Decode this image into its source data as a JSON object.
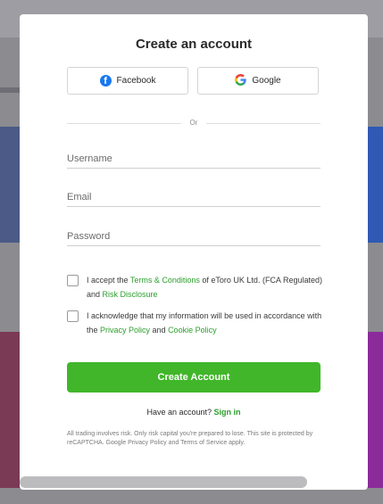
{
  "modal": {
    "title": "Create an account",
    "social": {
      "facebook_label": "Facebook",
      "google_label": "Google"
    },
    "or_text": "Or",
    "fields": {
      "username_placeholder": "Username",
      "email_placeholder": "Email",
      "password_placeholder": "Password"
    },
    "terms": {
      "pre": "I accept the ",
      "terms_link": "Terms & Conditions",
      "mid": " of eToro UK Ltd. (FCA Regulated) and ",
      "risk_link": "Risk Disclosure",
      "checked": false
    },
    "privacy": {
      "pre": "I acknowledge that my information will be used in accordance with the ",
      "privacy_link": "Privacy Policy",
      "mid": " and ",
      "cookie_link": "Cookie Policy",
      "checked": false
    },
    "create_button_label": "Create Account",
    "have_account": {
      "text": "Have an account? ",
      "signin_link": "Sign in"
    },
    "disclaimer": "All trading involves risk. Only risk capital you're prepared to lose. This site is protected by reCAPTCHA. Google Privacy Policy and Terms of Service apply."
  },
  "colors": {
    "accent_green": "#41b62a",
    "link_green": "#2c9e2c",
    "facebook_blue": "#1877f2"
  },
  "icons": {
    "facebook": "facebook-icon",
    "google": "google-icon"
  }
}
